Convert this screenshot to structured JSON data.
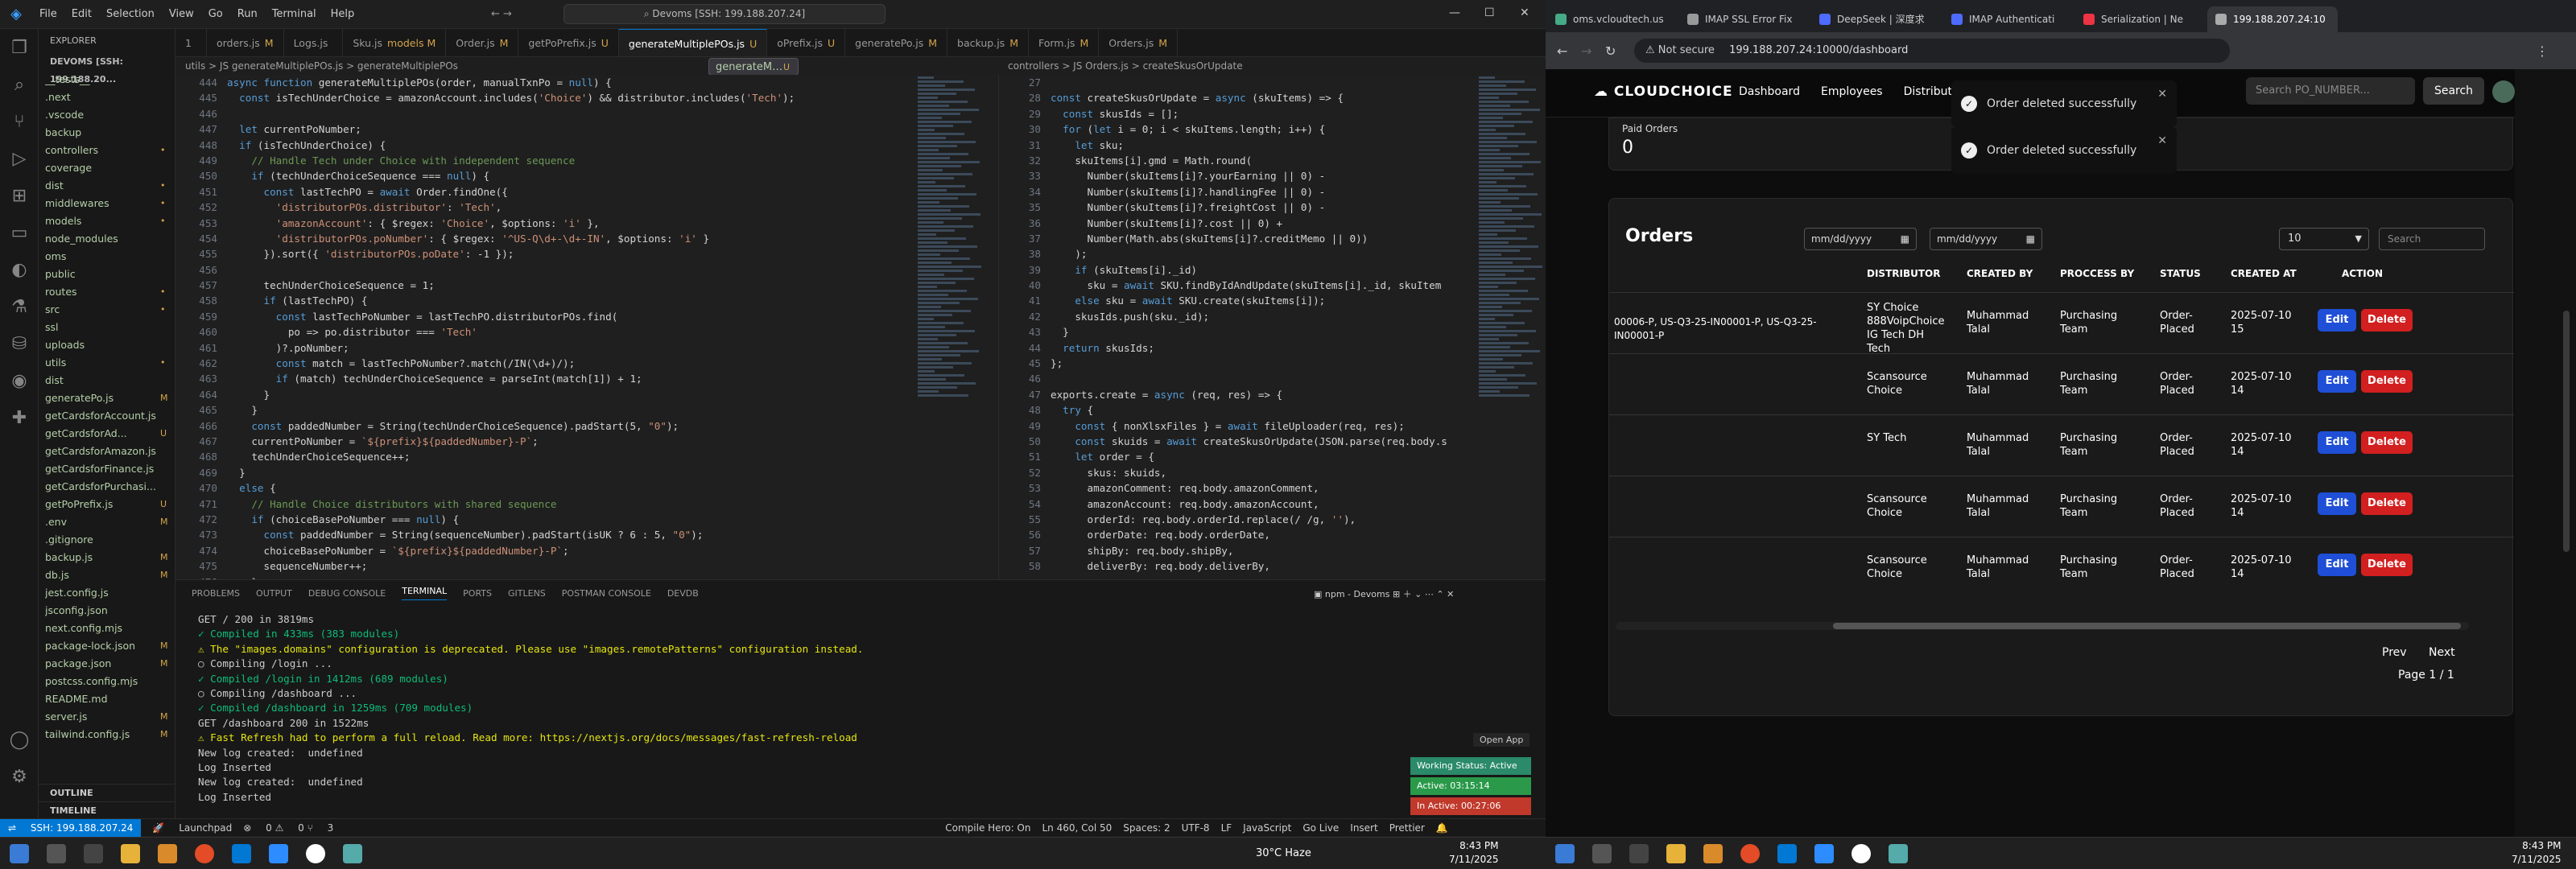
{
  "vscode": {
    "menu": [
      "File",
      "Edit",
      "Selection",
      "View",
      "Go",
      "Run",
      "Terminal",
      "Help"
    ],
    "command_center": "Devoms [SSH: 199.188.207.24]",
    "explorer_title": "EXPLORER",
    "workspace": "DEVOMS [SSH: 199.188.20...",
    "tree": [
      {
        "name": "__tests__",
        "status": ""
      },
      {
        "name": ".next",
        "status": ""
      },
      {
        "name": ".vscode",
        "status": ""
      },
      {
        "name": "backup",
        "status": ""
      },
      {
        "name": "controllers",
        "status": "•"
      },
      {
        "name": "coverage",
        "status": ""
      },
      {
        "name": "dist",
        "status": "•"
      },
      {
        "name": "middlewares",
        "status": "•"
      },
      {
        "name": "models",
        "status": "•"
      },
      {
        "name": "node_modules",
        "status": ""
      },
      {
        "name": "oms",
        "status": ""
      },
      {
        "name": "public",
        "status": ""
      },
      {
        "name": "routes",
        "status": "•"
      },
      {
        "name": "src",
        "status": "•"
      },
      {
        "name": "ssl",
        "status": ""
      },
      {
        "name": "uploads",
        "status": ""
      },
      {
        "name": "utils",
        "status": "•"
      },
      {
        "name": "dist",
        "status": ""
      },
      {
        "name": "generateMulti...",
        "status": "U"
      },
      {
        "name": "generatePo.js",
        "status": "M"
      },
      {
        "name": "getCardsforAccount.js",
        "status": ""
      },
      {
        "name": "getCardsforAd...",
        "status": "U"
      },
      {
        "name": "getCardsforAmazon.js",
        "status": ""
      },
      {
        "name": "getCardsforFinance.js",
        "status": ""
      },
      {
        "name": "getCardsforPurchasi...",
        "status": ""
      },
      {
        "name": "getPoPrefix.js",
        "status": "U"
      },
      {
        "name": ".env",
        "status": "M"
      },
      {
        "name": ".gitignore",
        "status": ""
      },
      {
        "name": "backup.js",
        "status": "M"
      },
      {
        "name": "db.js",
        "status": "M"
      },
      {
        "name": "jest.config.js",
        "status": ""
      },
      {
        "name": "jsconfig.json",
        "status": ""
      },
      {
        "name": "next.config.mjs",
        "status": ""
      },
      {
        "name": "package-lock.json",
        "status": "M"
      },
      {
        "name": "package.json",
        "status": "M"
      },
      {
        "name": "postcss.config.mjs",
        "status": ""
      },
      {
        "name": "README.md",
        "status": ""
      },
      {
        "name": "server.js",
        "status": "M"
      },
      {
        "name": "tailwind.config.js",
        "status": "M"
      }
    ],
    "outline": "OUTLINE",
    "timeline": "TIMELINE",
    "tabs": [
      {
        "name": "1",
        "mod": ""
      },
      {
        "name": "orders.js",
        "mod": "M"
      },
      {
        "name": "Logs.js",
        "mod": ""
      },
      {
        "name": "Sku.js",
        "mod": "models M"
      },
      {
        "name": "Order.js",
        "mod": "M"
      },
      {
        "name": "getPoPrefix.js",
        "mod": "U"
      },
      {
        "name": "generateMultiplePOs.js",
        "mod": "U"
      },
      {
        "name": "oPrefix.js",
        "mod": "U"
      },
      {
        "name": "generatePo.js",
        "mod": "M"
      },
      {
        "name": "backup.js",
        "mod": "M"
      },
      {
        "name": "Form.js",
        "mod": "M"
      },
      {
        "name": "Orders.js",
        "mod": "M"
      }
    ],
    "breadcrumb_left": "utils > JS generateMultiplePOs.js > generateMultiplePOs",
    "breadcrumb_right": "controllers > JS Orders.js > createSkusOrUpdate",
    "left_start_line": 444,
    "left_code": [
      "async function generateMultiplePOs(order, manualTxnPo = null) {",
      "  const isTechUnderChoice = amazonAccount.includes('Choice') && distributor.includes('Tech');",
      "",
      "  let currentPoNumber;",
      "  if (isTechUnderChoice) {",
      "    // Handle Tech under Choice with independent sequence",
      "    if (techUnderChoiceSequence === null) {",
      "      const lastTechPO = await Order.findOne({",
      "        'distributorPOs.distributor': 'Tech',",
      "        'amazonAccount': { $regex: 'Choice', $options: 'i' },",
      "        'distributorPOs.poNumber': { $regex: '^US-Q\\d+-\\d+-IN', $options: 'i' }",
      "      }).sort({ 'distributorPOs.poDate': -1 });",
      "",
      "      techUnderChoiceSequence = 1;",
      "      if (lastTechPO) {",
      "        const lastTechPoNumber = lastTechPO.distributorPOs.find(",
      "          po => po.distributor === 'Tech'",
      "        )?.poNumber;",
      "        const match = lastTechPoNumber?.match(/IN(\\d+)/);",
      "        if (match) techUnderChoiceSequence = parseInt(match[1]) + 1;",
      "      }",
      "    }",
      "    const paddedNumber = String(techUnderChoiceSequence).padStart(5, \"0\");",
      "    currentPoNumber = `${prefix}${paddedNumber}-P`;",
      "    techUnderChoiceSequence++;",
      "  }",
      "  else {",
      "    // Handle Choice distributors with shared sequence",
      "    if (choiceBasePoNumber === null) {",
      "      const paddedNumber = String(sequenceNumber).padStart(isUK ? 6 : 5, \"0\");",
      "      choiceBasePoNumber = `${prefix}${paddedNumber}-P`;",
      "      sequenceNumber++;",
      "    }"
    ],
    "right_start_line": 27,
    "right_code": [
      "",
      "const createSkusOrUpdate = async (skuItems) => {",
      "  const skusIds = [];",
      "  for (let i = 0; i < skuItems.length; i++) {",
      "    let sku;",
      "    skuItems[i].gmd = Math.round(",
      "      Number(skuItems[i]?.yourEarning || 0) -",
      "      Number(skuItems[i]?.handlingFee || 0) -",
      "      Number(skuItems[i]?.freightCost || 0) -",
      "      Number(skuItems[i]?.cost || 0) +",
      "      Number(Math.abs(skuItems[i]?.creditMemo || 0))",
      "    );",
      "    if (skuItems[i]._id)",
      "      sku = await SKU.findByIdAndUpdate(skuItems[i]._id, skuItem",
      "    else sku = await SKU.create(skuItems[i]);",
      "    skusIds.push(sku._id);",
      "  }",
      "  return skusIds;",
      "};",
      "",
      "exports.create = async (req, res) => {",
      "  try {",
      "    const { nonXlsxFiles } = await fileUploader(req, res);",
      "    const skuids = await createSkusOrUpdate(JSON.parse(req.body.s",
      "    let order = {",
      "      skus: skuids,",
      "      amazonComment: req.body.amazonComment,",
      "      amazonAccount: req.body.amazonAccount,",
      "      orderId: req.body.orderId.replace(/ /g, ''),",
      "      orderDate: req.body.orderDate,",
      "      shipBy: req.body.shipBy,",
      "      deliverBy: req.body.deliverBy,"
    ],
    "panel_tabs": [
      "PROBLEMS",
      "OUTPUT",
      "DEBUG CONSOLE",
      "TERMINAL",
      "PORTS",
      "GITLENS",
      "POSTMAN CONSOLE",
      "DEVDB"
    ],
    "ports_count": "3",
    "terminal_name": "npm - Devoms",
    "terminal_lines": [
      {
        "text": "GET / 200 in 3819ms",
        "cls": ""
      },
      {
        "text": "✓ Compiled in 433ms (383 modules)",
        "cls": "ok"
      },
      {
        "text": "⚠ The \"images.domains\" configuration is deprecated. Please use \"images.remotePatterns\" configuration instead.",
        "cls": "warn"
      },
      {
        "text": "○ Compiling /login ...",
        "cls": ""
      },
      {
        "text": "✓ Compiled /login in 1412ms (689 modules)",
        "cls": "ok"
      },
      {
        "text": "○ Compiling /dashboard ...",
        "cls": ""
      },
      {
        "text": "✓ Compiled /dashboard in 1259ms (709 modules)",
        "cls": "ok"
      },
      {
        "text": "GET /dashboard 200 in 1522ms",
        "cls": ""
      },
      {
        "text": "⚠ Fast Refresh had to perform a full reload. Read more: https://nextjs.org/docs/messages/fast-refresh-reload",
        "cls": "warn"
      },
      {
        "text": "New log created:  undefined",
        "cls": ""
      },
      {
        "text": "Log Inserted",
        "cls": ""
      },
      {
        "text": "New log created:  undefined",
        "cls": ""
      },
      {
        "text": "Log Inserted",
        "cls": ""
      }
    ],
    "open_app": "Open App",
    "working_status": "Working Status: Active",
    "active_time": "Active: 03:15:14",
    "inactive_time": "In Active: 00:27:06",
    "status": {
      "remote": "SSH: 199.188.207.24",
      "launchpad": "Launchpad",
      "errors": "0",
      "warnings": "0",
      "ports": "3",
      "compile_hero": "Compile Hero: On",
      "position": "Ln 460, Col 50",
      "spaces": "Spaces: 2",
      "encoding": "UTF-8",
      "eol": "LF",
      "language": "JavaScript",
      "go_live": "Go Live",
      "insert": "Insert",
      "prettier": "Prettier"
    }
  },
  "browser": {
    "tabs": [
      {
        "title": "oms.vcloudtech.us",
        "color": "#4a8"
      },
      {
        "title": "IMAP SSL Error Fix",
        "color": "#999"
      },
      {
        "title": "DeepSeek | 深度求",
        "color": "#4d6bfe"
      },
      {
        "title": "IMAP Authenticati",
        "color": "#4d6bfe"
      },
      {
        "title": "Serialization | Ne",
        "color": "#e34"
      },
      {
        "title": "199.188.207.24:10",
        "color": "#aaa"
      }
    ],
    "not_secure": "Not secure",
    "url": "199.188.207.24:10000/dashboard",
    "logo": "CLOUDCHOICE",
    "nav": [
      "Dashboard",
      "Employees",
      "Distributors"
    ],
    "search_placeholder": "Search PO_NUMBER...",
    "search_button": "Search",
    "paid_label": "Paid Orders",
    "paid_value": "0",
    "toasts": [
      "Order deleted successfully",
      "Order deleted successfully"
    ],
    "orders_title": "Orders",
    "date_placeholder": "mm/dd/yyyy",
    "page_size": "10",
    "filter_placeholder": "Search",
    "columns": [
      "DISTRIBUTOR",
      "CREATED BY",
      "PROCCESS BY",
      "STATUS",
      "CREATED AT",
      "ACTION"
    ],
    "rows": [
      {
        "po": "00006-P, US-Q3-25-IN00001-P, US-Q3-25-IN00001-P",
        "distributor": "SY Choice 888VoipChoice IG Tech DH Tech",
        "created_by": "Muhammad Talal",
        "process_by": "Purchasing Team",
        "status": "Order-Placed",
        "created_at": "2025-07-10 15"
      },
      {
        "po": "",
        "distributor": "Scansource Choice",
        "created_by": "Muhammad Talal",
        "process_by": "Purchasing Team",
        "status": "Order-Placed",
        "created_at": "2025-07-10 14"
      },
      {
        "po": "",
        "distributor": "SY Tech",
        "created_by": "Muhammad Talal",
        "process_by": "Purchasing Team",
        "status": "Order-Placed",
        "created_at": "2025-07-10 14"
      },
      {
        "po": "",
        "distributor": "Scansource Choice",
        "created_by": "Muhammad Talal",
        "process_by": "Purchasing Team",
        "status": "Order-Placed",
        "created_at": "2025-07-10 14"
      },
      {
        "po": "",
        "distributor": "Scansource Choice",
        "created_by": "Muhammad Talal",
        "process_by": "Purchasing Team",
        "status": "Order-Placed",
        "created_at": "2025-07-10 14"
      }
    ],
    "edit_label": "Edit",
    "delete_label": "Delete",
    "prev": "Prev",
    "next": "Next",
    "page_info": "Page 1 / 1"
  },
  "taskbar": {
    "left_weather": "30°C  Haze",
    "left_time": "8:43 PM",
    "left_date": "7/11/2025",
    "right_time": "8:43 PM",
    "right_date": "7/11/2025"
  }
}
